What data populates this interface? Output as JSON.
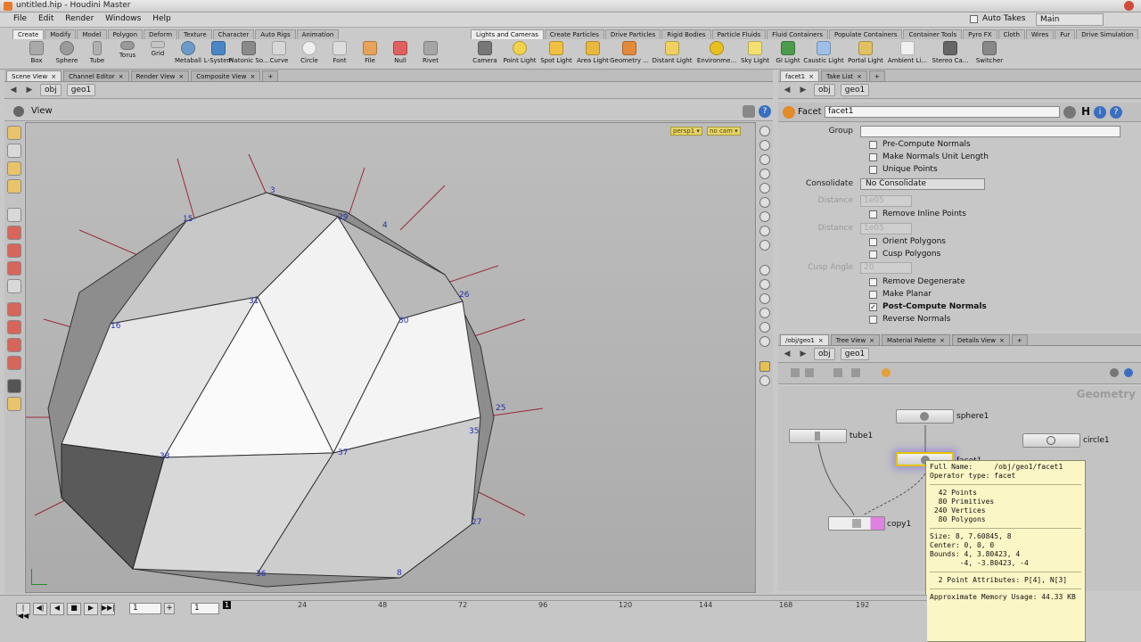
{
  "window": {
    "title": "untitled.hip - Houdini Master",
    "auto_takes_label": "Auto Takes",
    "desktop": "Main"
  },
  "menu": [
    "File",
    "Edit",
    "Render",
    "Windows",
    "Help"
  ],
  "shelf_left": {
    "tabs": [
      "Create",
      "Modify",
      "Model",
      "Polygon",
      "Deform",
      "Texture",
      "Character",
      "Auto Rigs",
      "Animation"
    ],
    "tools": [
      "Box",
      "Sphere",
      "Tube",
      "Torus",
      "Grid",
      "Metaball",
      "L-System",
      "Platonic So...",
      "Curve",
      "Circle",
      "Font",
      "File",
      "Null",
      "Rivet"
    ]
  },
  "shelf_right": {
    "tabs": [
      "Lights and Cameras",
      "Create Particles",
      "Drive Particles",
      "Rigid Bodies",
      "Particle Fluids",
      "Fluid Containers",
      "Populate Containers",
      "Container Tools",
      "Pyro FX",
      "Cloth",
      "Wires",
      "Fur",
      "Drive Simulation"
    ],
    "tools": [
      "Camera",
      "Point Light",
      "Spot Light",
      "Area Light",
      "Geometry ...",
      "Distant Light",
      "Environme...",
      "Sky Light",
      "GI Light",
      "Caustic Light",
      "Portal Light",
      "Ambient Li...",
      "Stereo Ca...",
      "Switcher"
    ]
  },
  "viewer": {
    "tabs": [
      "Scene View",
      "Channel Editor",
      "Render View",
      "Composite View"
    ],
    "path": [
      "obj",
      "geo1"
    ],
    "title": "View",
    "cam_labels": [
      "persp1 ▾",
      "no cam ▾"
    ],
    "point_labels": [
      "3",
      "15",
      "29",
      "4",
      "26",
      "31",
      "30",
      "16",
      "25",
      "35",
      "38",
      "37",
      "27",
      "36",
      "8"
    ]
  },
  "params": {
    "tabs": [
      "facet1",
      "Take List"
    ],
    "path": [
      "obj",
      "geo1"
    ],
    "node_type": "Facet",
    "node_name": "facet1",
    "group_label": "Group",
    "consolidate_label": "Consolidate",
    "consolidate_value": "No Consolidate",
    "distance_label": "Distance",
    "distance_value_1": "1e05",
    "distance_value_2": "1e05",
    "cusp_angle_label": "Cusp Angle",
    "cusp_angle_value": "20",
    "checkboxes": [
      {
        "label": "Pre-Compute Normals",
        "checked": false
      },
      {
        "label": "Make Normals Unit Length",
        "checked": false
      },
      {
        "label": "Unique Points",
        "checked": false
      },
      {
        "label": "Remove Inline Points",
        "checked": false
      },
      {
        "label": "Orient Polygons",
        "checked": false
      },
      {
        "label": "Cusp Polygons",
        "checked": false
      },
      {
        "label": "Remove Degenerate",
        "checked": false
      },
      {
        "label": "Make Planar",
        "checked": false
      },
      {
        "label": "Post-Compute Normals",
        "checked": true
      },
      {
        "label": "Reverse Normals",
        "checked": false
      }
    ]
  },
  "network": {
    "tabs": [
      "/obj/geo1",
      "Tree View",
      "Material Palette",
      "Details View"
    ],
    "path": [
      "obj",
      "geo1"
    ],
    "context_label": "Geometry",
    "nodes": [
      "sphere1",
      "tube1",
      "circle1",
      "facet1",
      "copy1"
    ]
  },
  "tooltip": {
    "full_name": "Full Name:     /obj/geo1/facet1",
    "op_type": "Operator type: facet",
    "points": "  42 Points",
    "prims": "  80 Primitives",
    "verts": " 240 Vertices",
    "polys": "  80 Polygons",
    "size": "Size: 8, 7.60845, 8",
    "center": "Center: 0, 0, 0",
    "bounds1": "Bounds: 4, 3.80423, 4",
    "bounds2": "       -4, -3.80423, -4",
    "attribs": "  2 Point Attributes: P[4], N[3]",
    "memory": "Approximate Memory Usage: 44.33 KB"
  },
  "timeline": {
    "frame": "1",
    "start": "1",
    "ticks": [
      "1",
      "24",
      "48",
      "72",
      "96",
      "120",
      "144",
      "168",
      "192"
    ]
  }
}
